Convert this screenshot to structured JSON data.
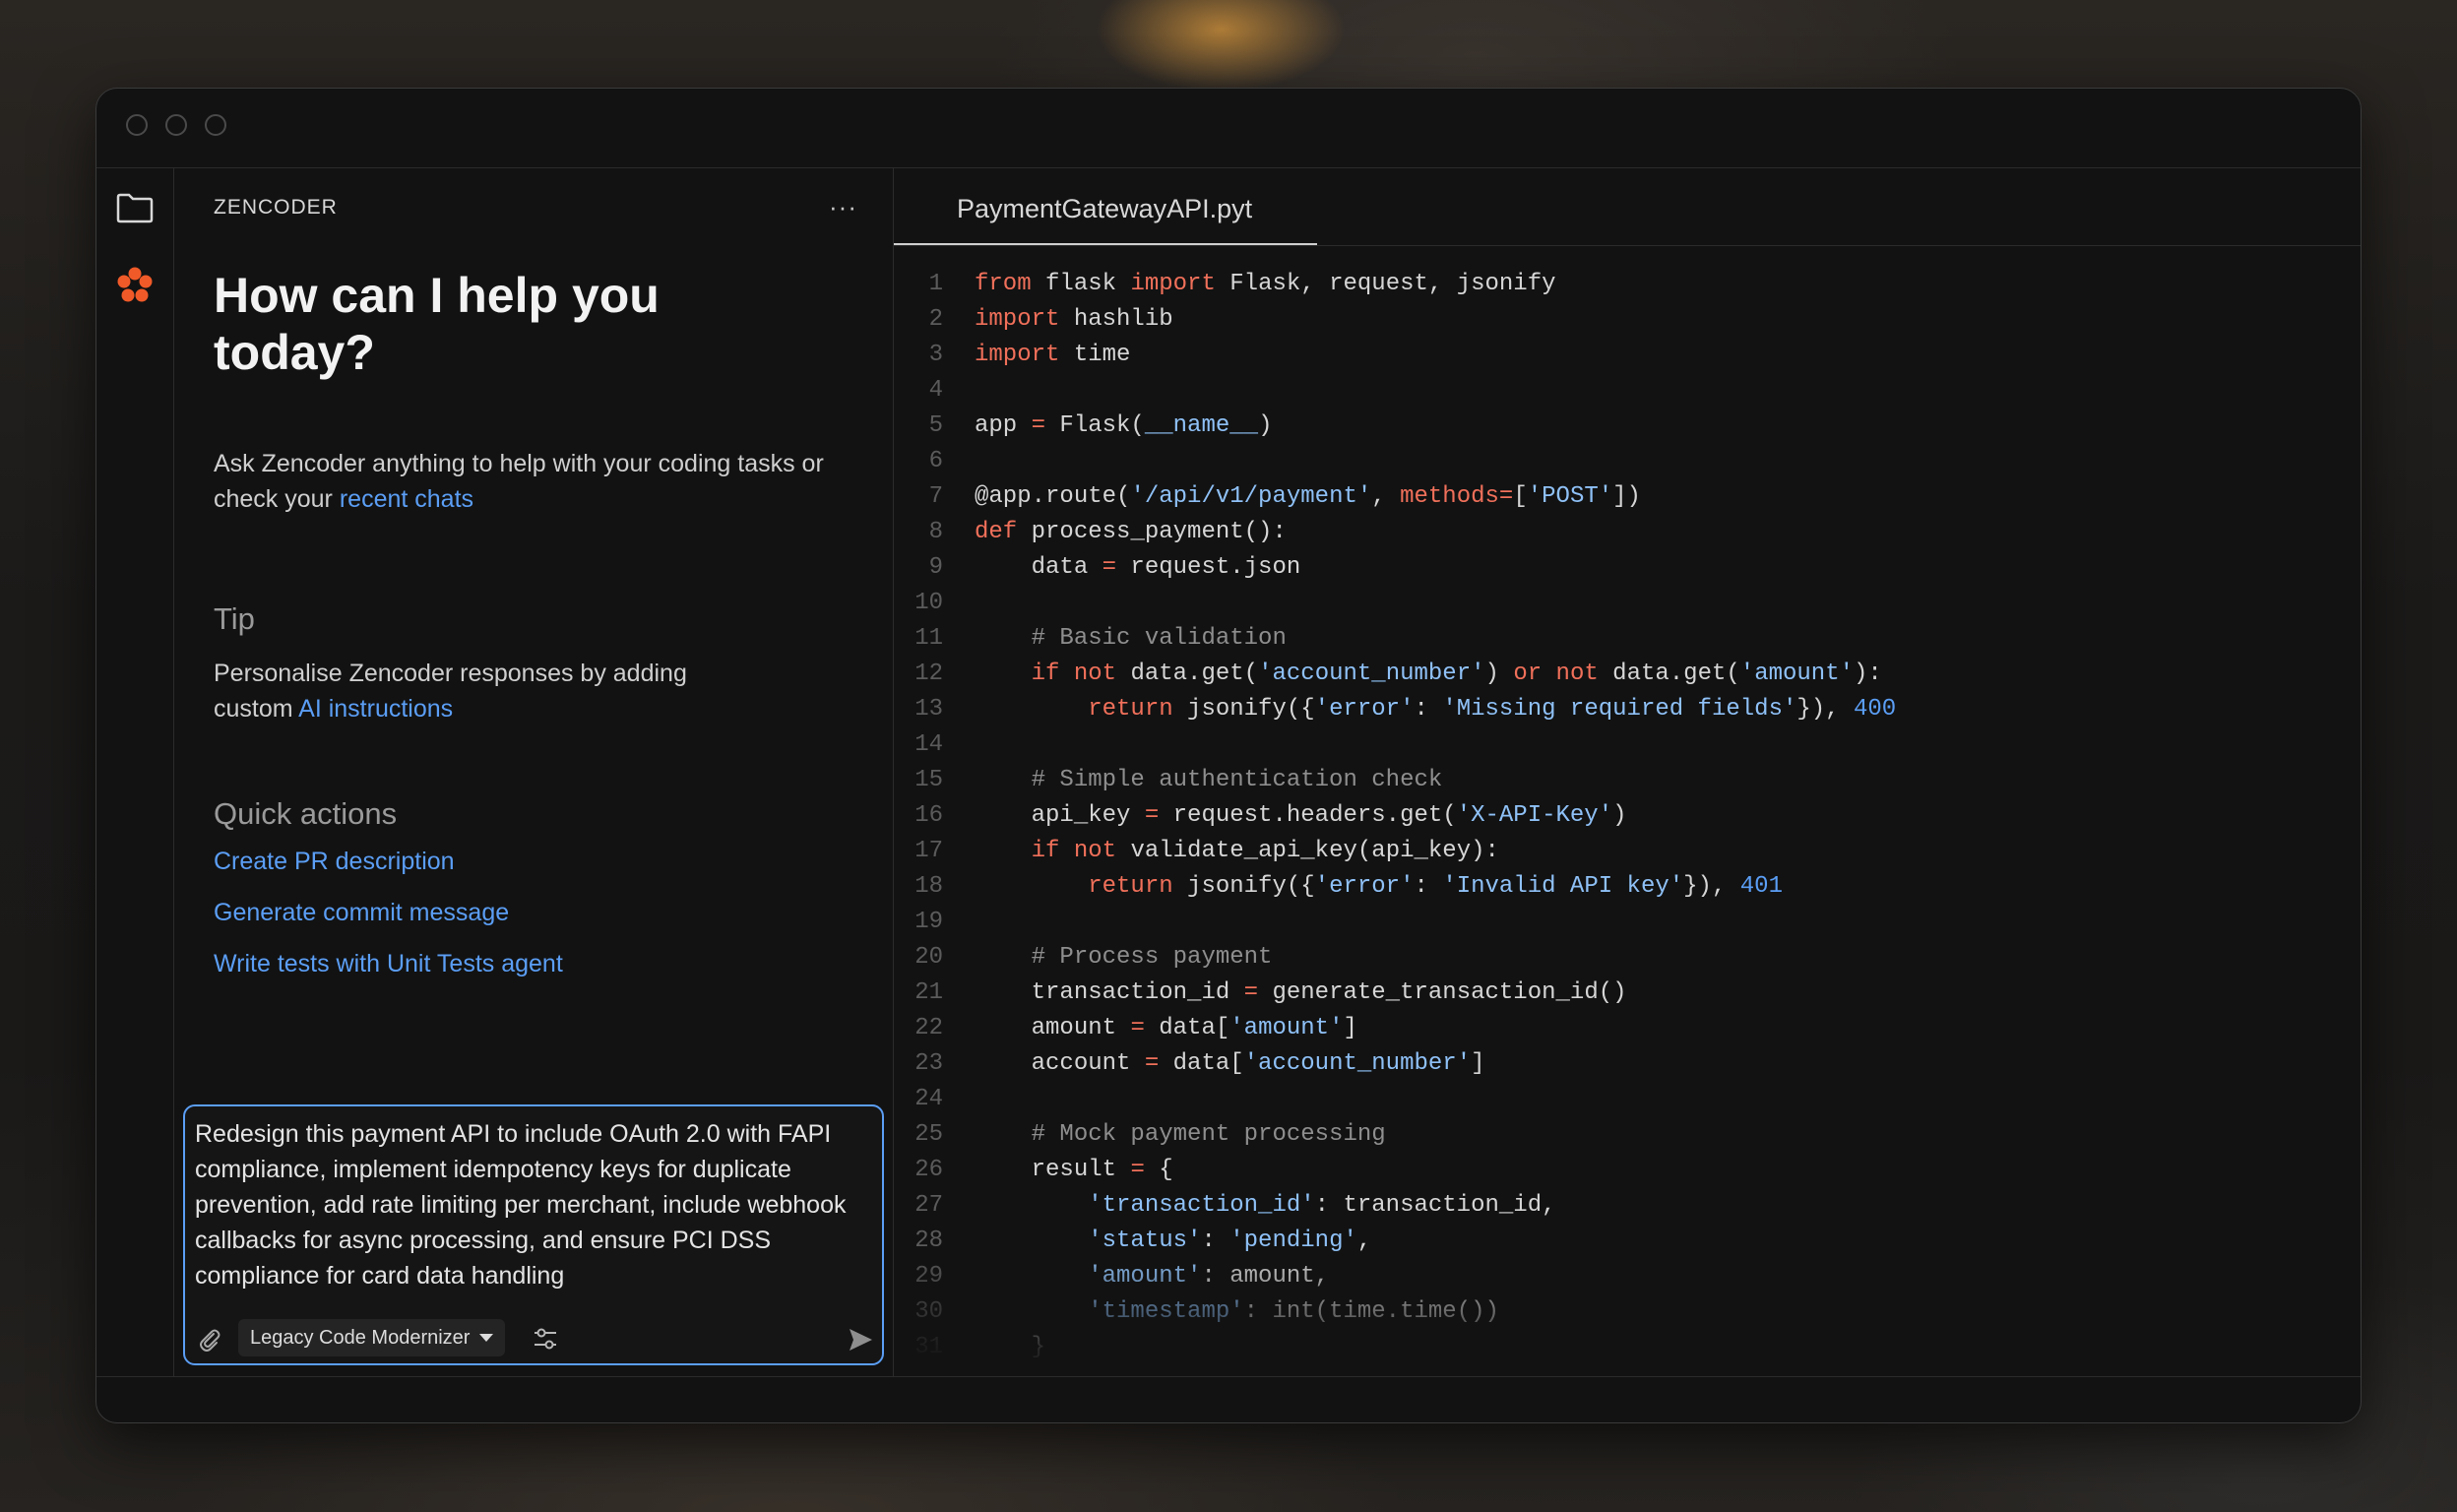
{
  "app": {
    "brand": "ZENCODER",
    "menu_glyph": "···"
  },
  "chat": {
    "headline": "How can I help you today?",
    "intro_prefix": "Ask Zencoder anything to help with your coding tasks or check your ",
    "intro_link": "recent chats",
    "tip_title": "Tip",
    "tip_prefix": "Personalise Zencoder responses by adding custom ",
    "tip_link": "AI instructions",
    "quick_actions_title": "Quick actions",
    "quick_actions": [
      "Create PR description",
      "Generate commit message",
      "Write tests with Unit Tests agent"
    ],
    "input_text": "Redesign this payment API to include OAuth 2.0 with FAPI compliance, implement idempotency keys for duplicate prevention, add rate limiting per merchant, include webhook callbacks for async processing, and ensure PCI DSS compliance for card data handling",
    "agent_mode": "Legacy Code Modernizer"
  },
  "editor": {
    "tab": "PaymentGatewayAPI.pyt",
    "lines": [
      "from flask import Flask, request, jsonify",
      "import hashlib",
      "import time",
      "",
      "app = Flask(__name__)",
      "",
      "@app.route('/api/v1/payment', methods=['POST'])",
      "def process_payment():",
      "    data = request.json",
      "",
      "    # Basic validation",
      "    if not data.get('account_number') or not data.get('amount'):",
      "        return jsonify({'error': 'Missing required fields'}), 400",
      "",
      "    # Simple authentication check",
      "    api_key = request.headers.get('X-API-Key')",
      "    if not validate_api_key(api_key):",
      "        return jsonify({'error': 'Invalid API key'}), 401",
      "",
      "    # Process payment",
      "    transaction_id = generate_transaction_id()",
      "    amount = data['amount']",
      "    account = data['account_number']",
      "",
      "    # Mock payment processing",
      "    result = {",
      "        'transaction_id': transaction_id,",
      "        'status': 'pending',",
      "        'amount': amount,",
      "        'timestamp': int(time.time())",
      "    }"
    ]
  },
  "colors": {
    "accent": "#5b9ef5",
    "keyword": "#f0705a",
    "string": "#8fc1f7",
    "logo": "#f05a28"
  },
  "icons": {
    "folder": "folder-icon",
    "logo": "zencoder-logo-icon",
    "attach": "paperclip-icon",
    "settings": "sliders-icon",
    "send": "send-icon"
  }
}
